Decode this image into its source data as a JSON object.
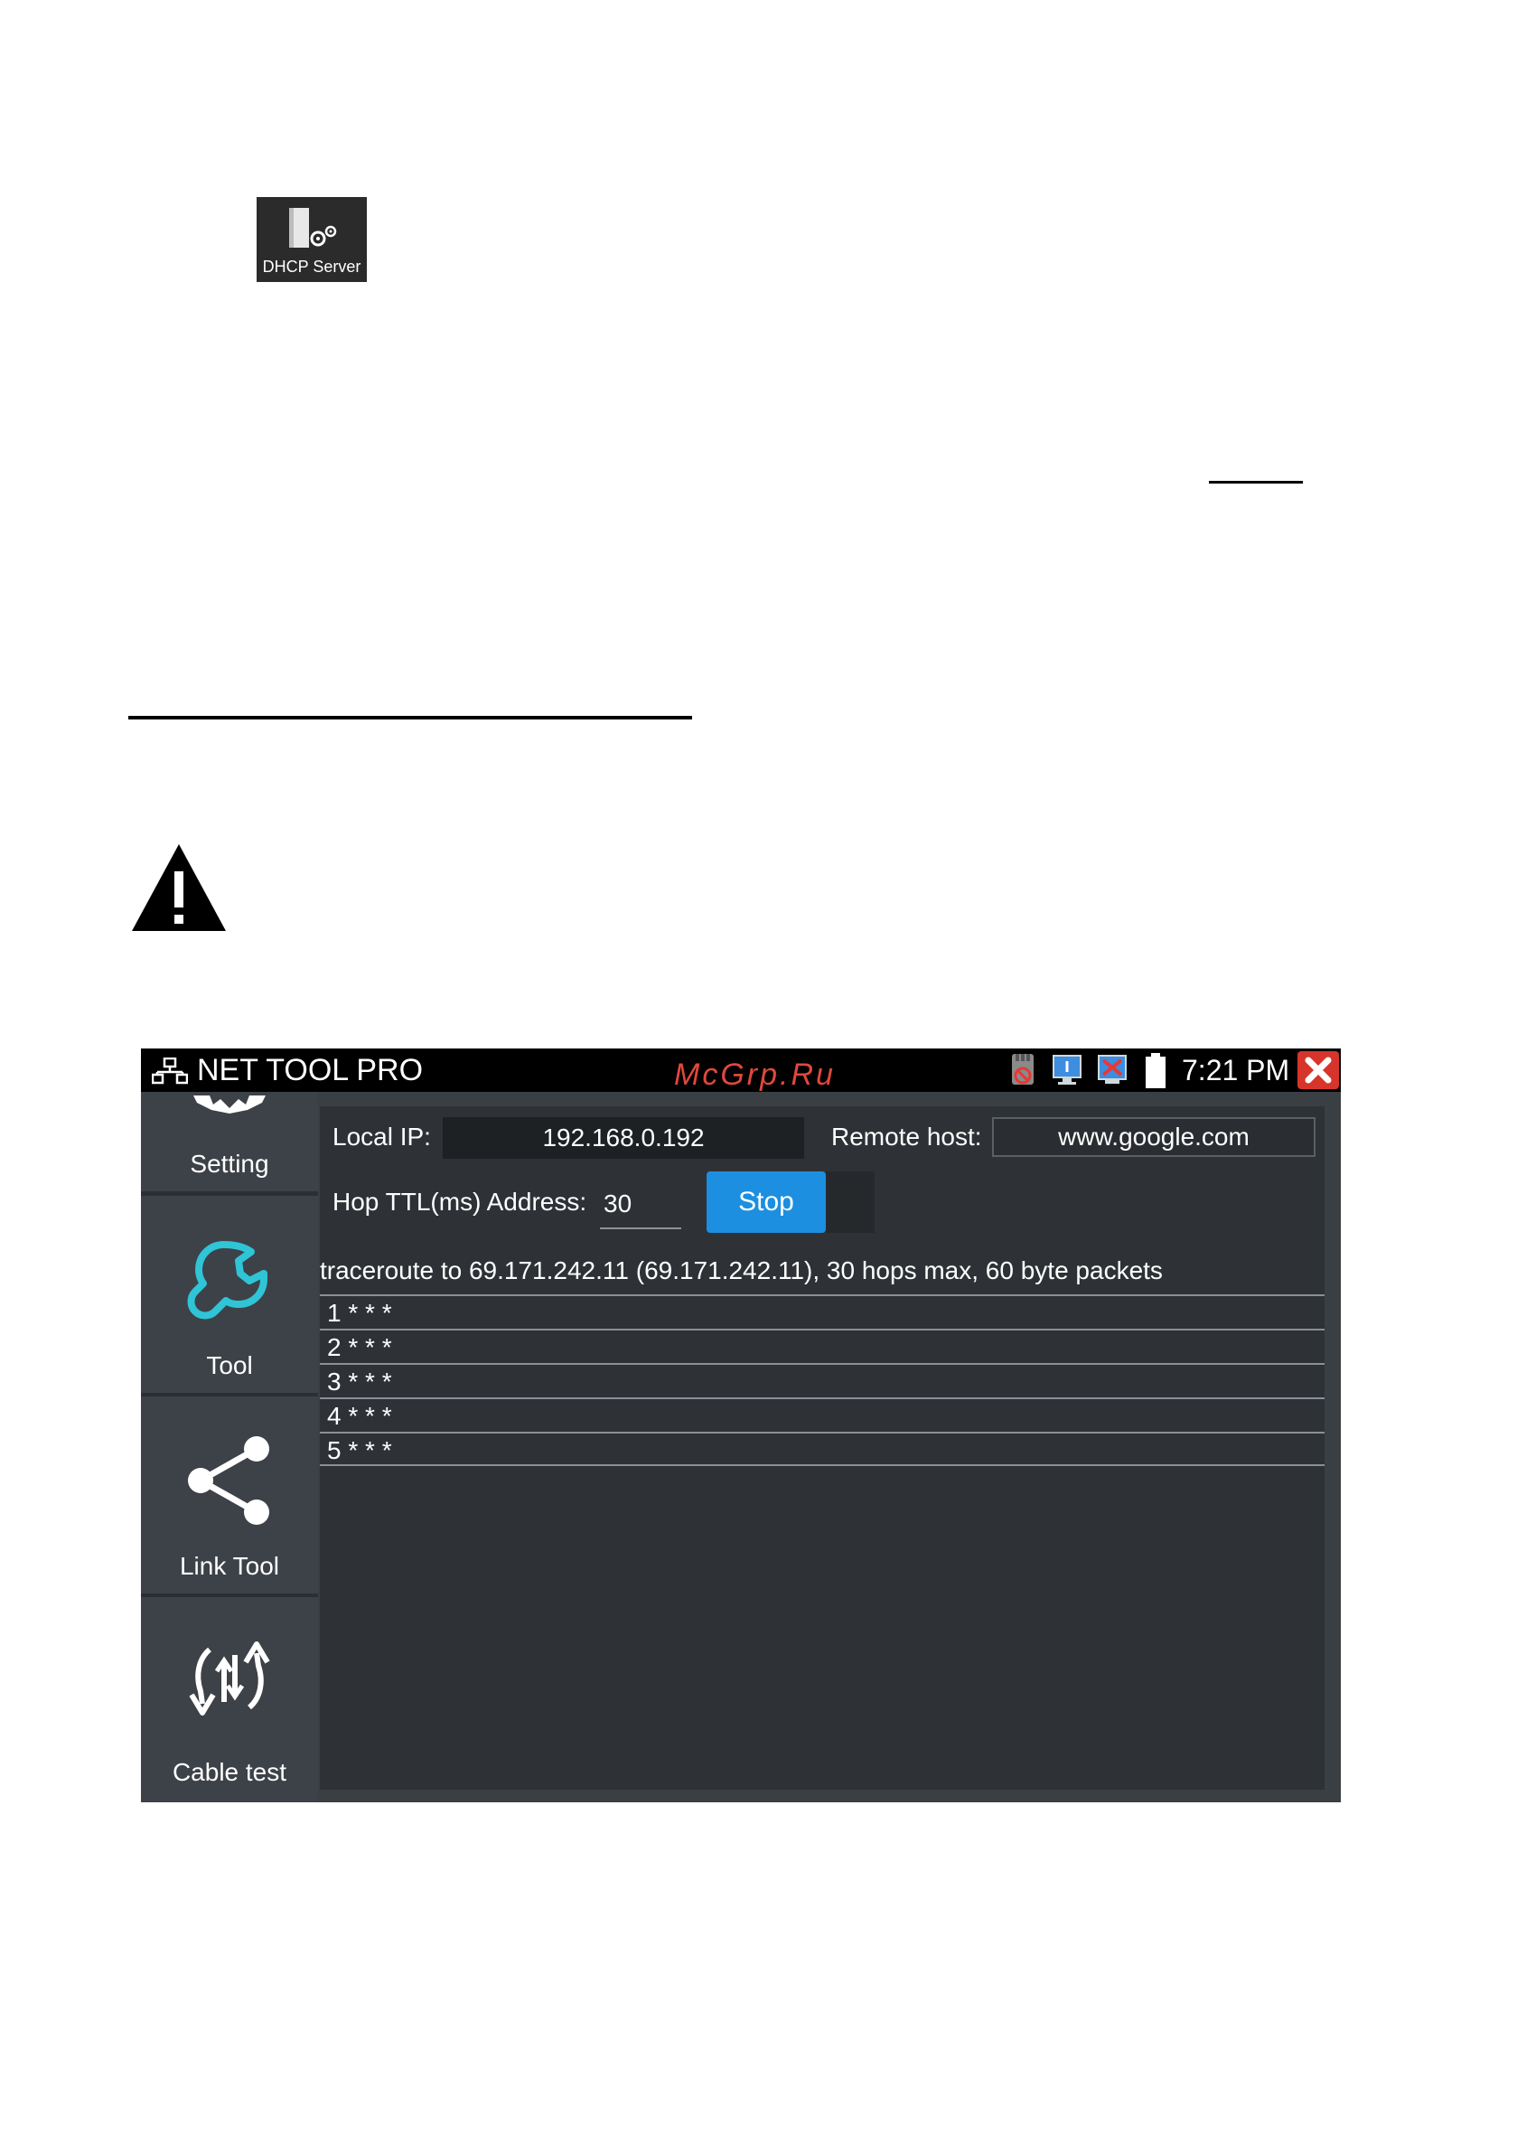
{
  "doc": {
    "dhcp_icon_label": "DHCP Server"
  },
  "status_bar": {
    "app_title": "NET TOOL PRO",
    "watermark": "McGrp.Ru",
    "time": "7:21 PM",
    "icons": [
      "network-icon",
      "sd-card-icon",
      "monitor-icon",
      "usb-icon",
      "battery-icon",
      "close-icon"
    ]
  },
  "sidebar": {
    "items": [
      {
        "label": "Setting",
        "icon": "gear-icon"
      },
      {
        "label": "Tool",
        "icon": "wrench-icon"
      },
      {
        "label": "Link Tool",
        "icon": "share-icon"
      },
      {
        "label": "Cable test",
        "icon": "cable-test-icon"
      }
    ]
  },
  "form": {
    "local_ip_label": "Local IP:",
    "local_ip_value": "192.168.0.192",
    "remote_host_label": "Remote host:",
    "remote_host_value": "www.google.com",
    "hop_label": "Hop TTL(ms) Address:",
    "hop_value": "30",
    "stop_label": "Stop"
  },
  "trace": {
    "header": "traceroute to 69.171.242.11 (69.171.242.11), 30 hops max, 60 byte packets",
    "rows": [
      "1 * * *",
      "2 * * *",
      "3 * * *",
      "4 * * *",
      "5 * * *"
    ]
  },
  "colors": {
    "accent": "#1c8fe0",
    "tool_icon": "#2fc4d6",
    "close": "#d7352b"
  }
}
